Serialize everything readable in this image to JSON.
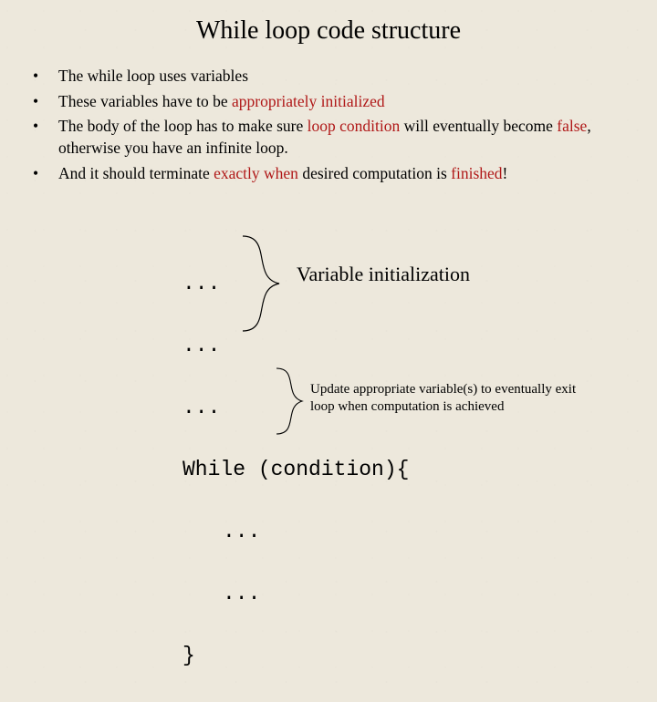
{
  "title": "While loop code structure",
  "bullets": {
    "b1": "The while loop uses variables",
    "b2a": "These variables have to be ",
    "b2b": "appropriately initialized",
    "b3a": "The body of the loop has to make sure ",
    "b3b": "loop condition",
    "b3c": " will eventually become ",
    "b3d": "false",
    "b3e": ", otherwise you have an infinite loop.",
    "b4a": "And it should terminate ",
    "b4b": "exactly when",
    "b4c": " desired computation is ",
    "b4d": "finished",
    "b4e": "!"
  },
  "code": {
    "d1": "...",
    "d2": "...",
    "d3": "...",
    "whileopen": "While (condition){",
    "body1": "...",
    "body2": "...",
    "close": "}"
  },
  "anno": {
    "init": "Variable initialization",
    "update": "Update appropriate variable(s) to eventually exit loop when computation is achieved"
  }
}
